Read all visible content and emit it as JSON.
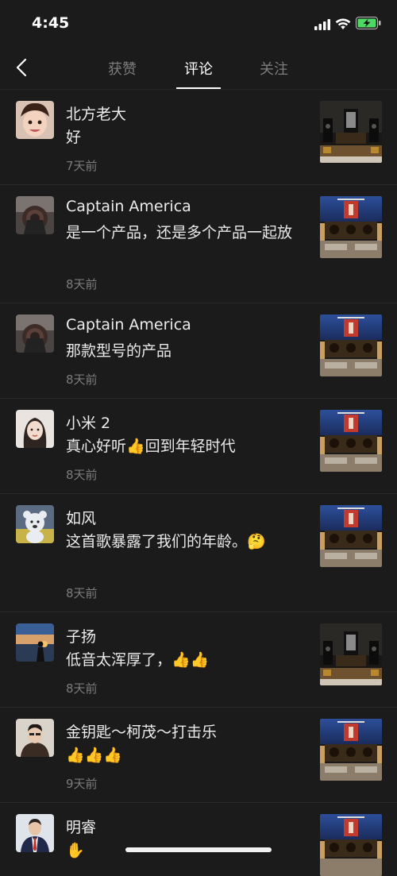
{
  "status": {
    "time": "4:45"
  },
  "tabs": [
    {
      "label": "获赞",
      "active": false
    },
    {
      "label": "评论",
      "active": true
    },
    {
      "label": "关注",
      "active": false
    }
  ],
  "comments": [
    {
      "name": "北方老大",
      "text": "好",
      "time": "7天前",
      "avatar": "avatar-child",
      "thumb": "thumb-hifi-room"
    },
    {
      "name": "Captain America",
      "text": "是一个产品，还是多个产品一起放",
      "time": "8天前",
      "avatar": "avatar-shield",
      "thumb": "thumb-hifi-stage"
    },
    {
      "name": "Captain America",
      "text": "那款型号的产品",
      "time": "8天前",
      "avatar": "avatar-shield",
      "thumb": "thumb-hifi-stage"
    },
    {
      "name": "小米 2",
      "text": "真心好听👍回到年轻时代",
      "time": "8天前",
      "avatar": "avatar-woman",
      "thumb": "thumb-hifi-stage"
    },
    {
      "name": "如风",
      "text": "这首歌暴露了我们的年龄。🤔",
      "time": "8天前",
      "avatar": "avatar-bear",
      "thumb": "thumb-hifi-stage"
    },
    {
      "name": "子扬",
      "text": "低音太浑厚了，👍👍",
      "time": "8天前",
      "avatar": "avatar-sunset",
      "thumb": "thumb-hifi-room"
    },
    {
      "name": "金钥匙～柯茂～打击乐",
      "text": "👍👍👍",
      "time": "9天前",
      "avatar": "avatar-man",
      "thumb": "thumb-hifi-stage"
    },
    {
      "name": "明睿",
      "text": "✋",
      "time": "",
      "avatar": "avatar-suit",
      "thumb": "thumb-hifi-stage"
    }
  ]
}
